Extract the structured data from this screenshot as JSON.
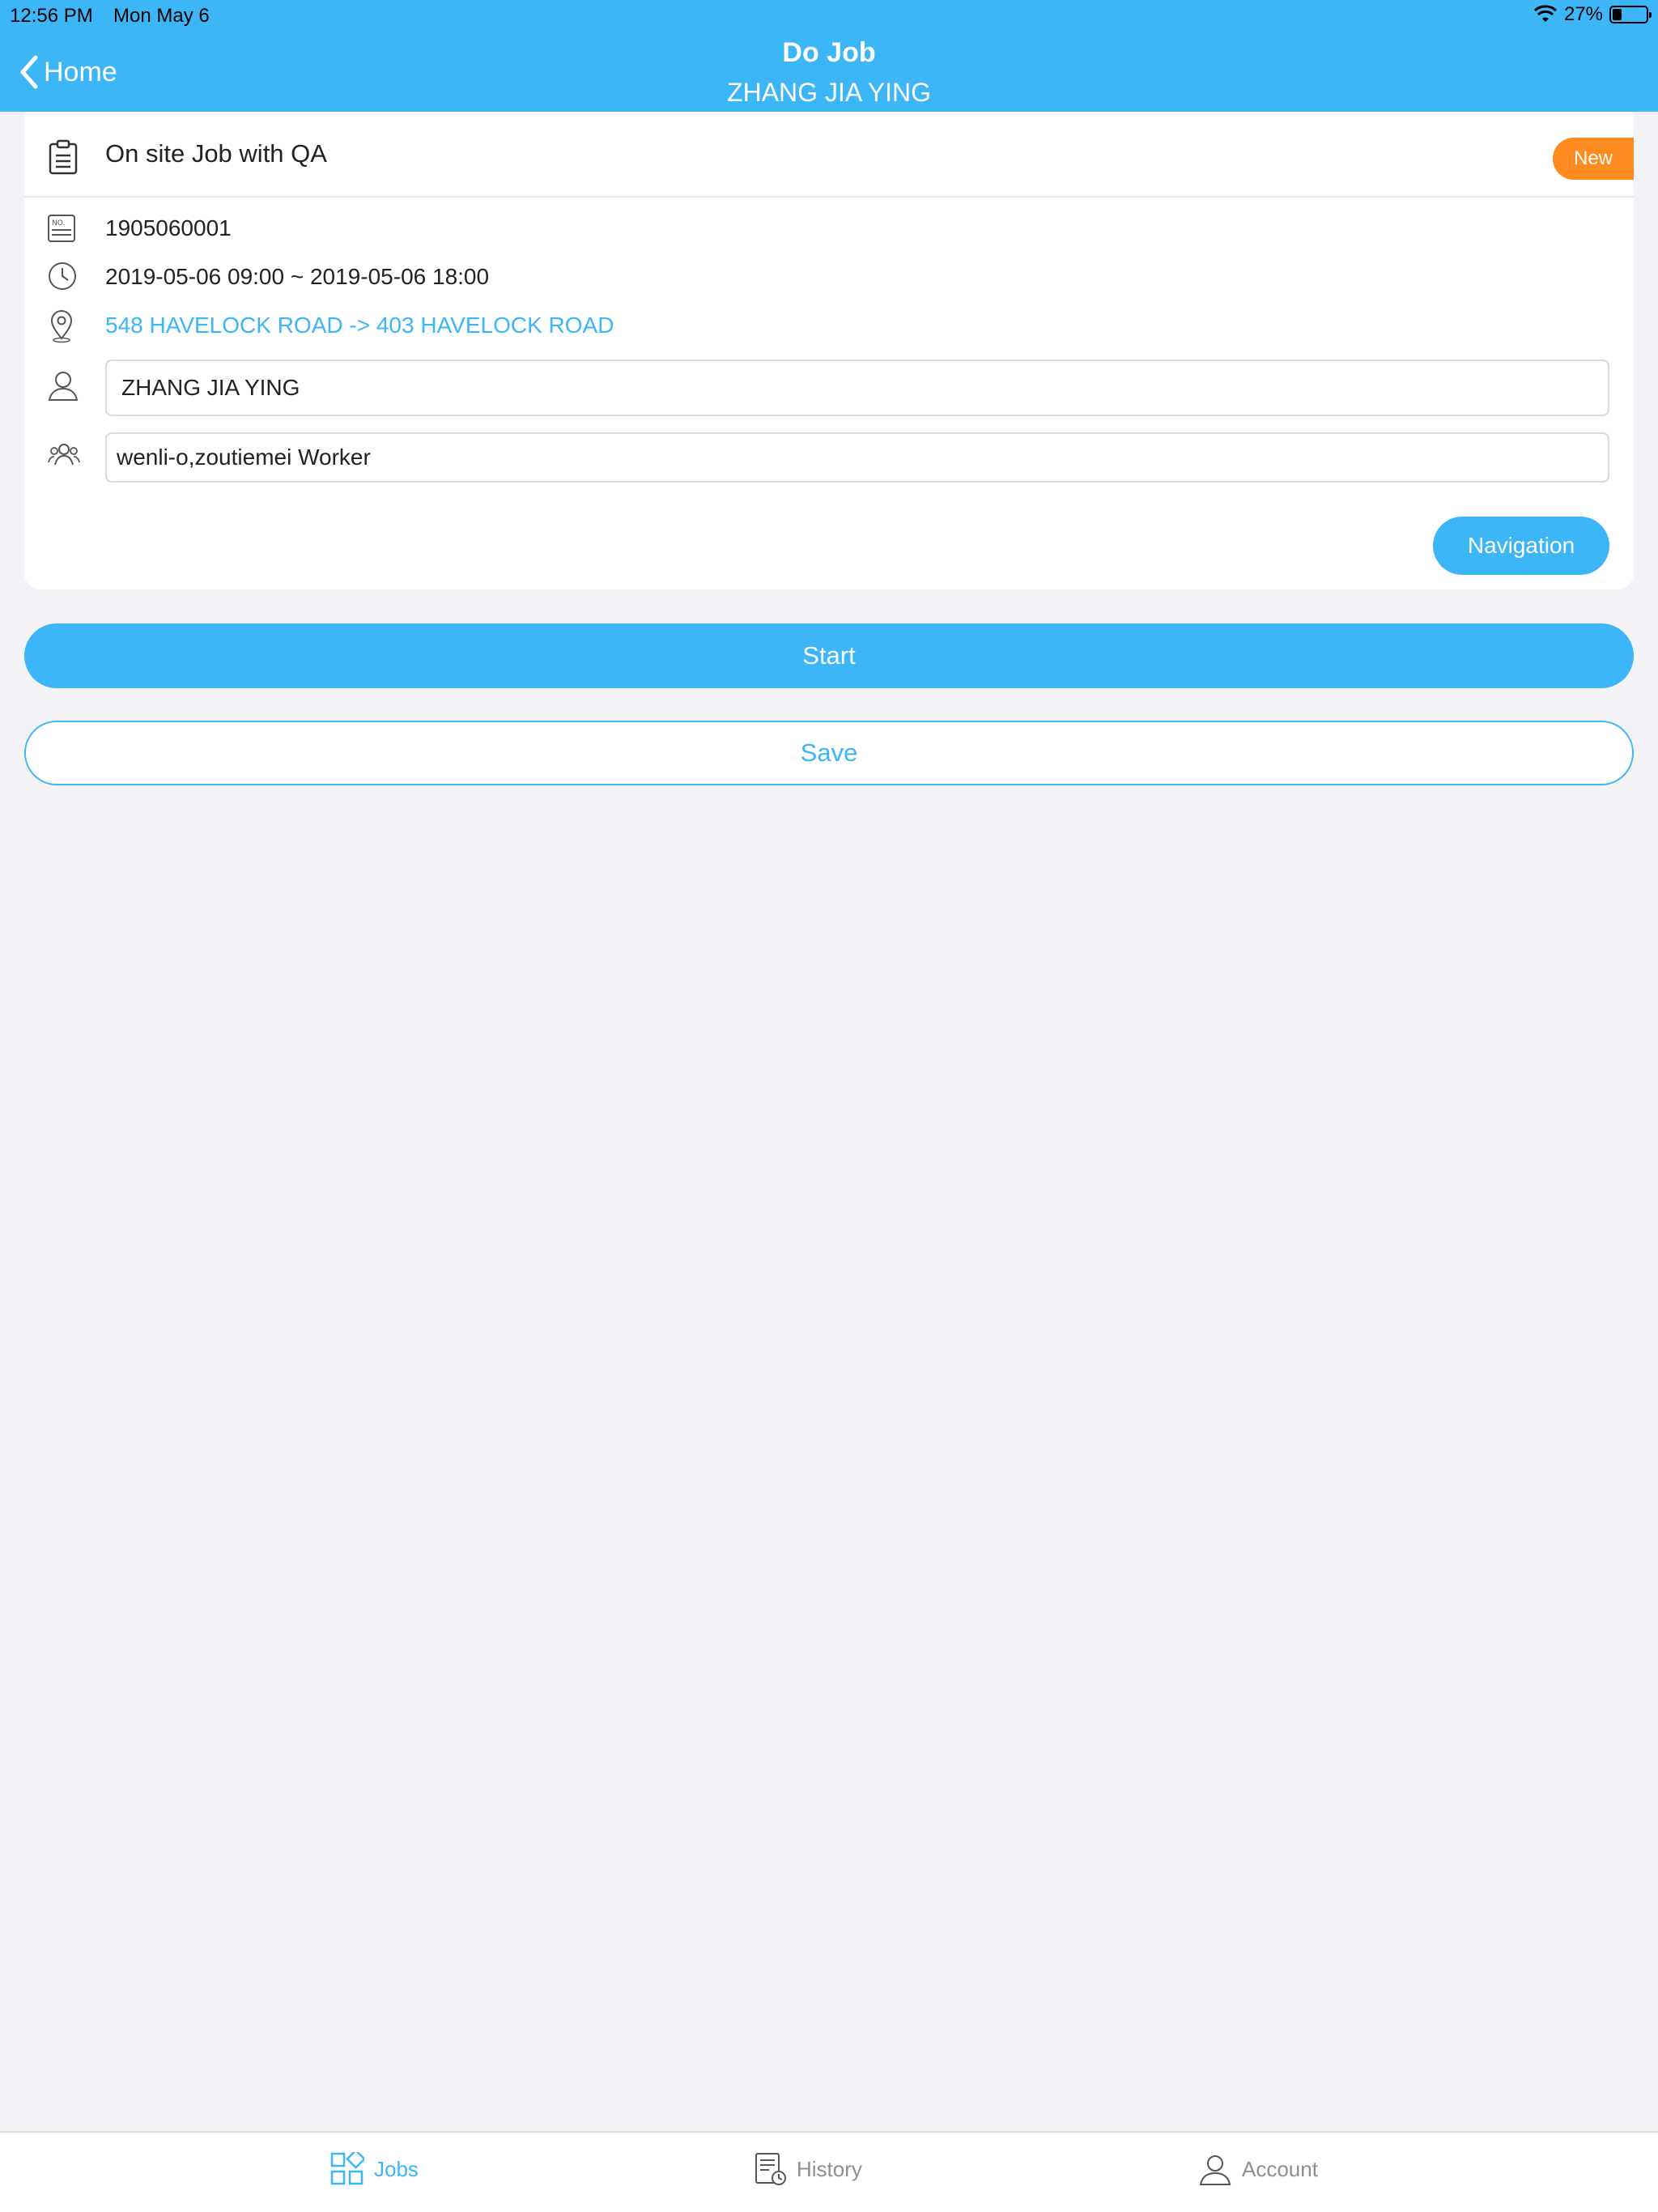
{
  "status_bar": {
    "time": "12:56 PM",
    "date": "Mon May 6",
    "battery": "27%",
    "battery_level": 0.27,
    "icons": [
      "wifi-icon",
      "battery-icon"
    ]
  },
  "nav": {
    "back_label": "Home",
    "title": "Do Job",
    "subtitle": "ZHANG JIA YING"
  },
  "job": {
    "title": "On site Job with QA",
    "badge": "New",
    "job_no": "1905060001",
    "time_range": "2019-05-06 09:00 ~ 2019-05-06 18:00",
    "route": "548 HAVELOCK ROAD -> 403 HAVELOCK ROAD",
    "customer": "ZHANG JIA YING",
    "workers": "wenli-o,zoutiemei Worker",
    "navigation_label": "Navigation"
  },
  "actions": {
    "start_label": "Start",
    "save_label": "Save"
  },
  "tabs": [
    {
      "label": "Jobs",
      "icon": "grid-icon",
      "active": true
    },
    {
      "label": "History",
      "icon": "history-icon",
      "active": false
    },
    {
      "label": "Account",
      "icon": "account-icon",
      "active": false
    }
  ],
  "colors": {
    "primary": "#3db6f7",
    "badge": "#ff8a1f",
    "background": "#f2f2f7",
    "inactive_tab": "#8e8e93"
  }
}
